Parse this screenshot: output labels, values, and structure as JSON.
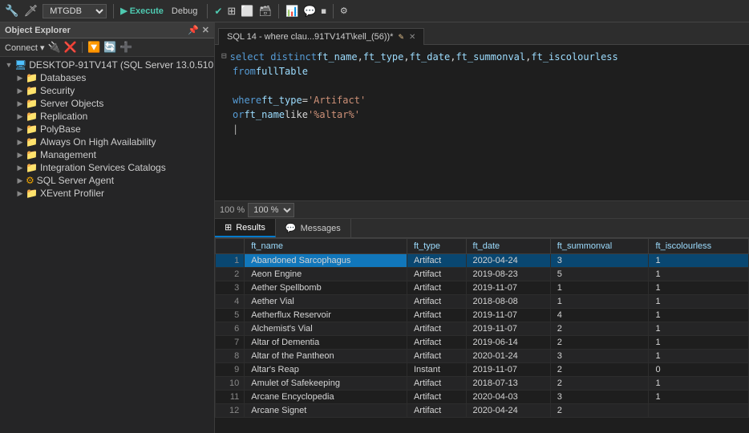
{
  "toolbar": {
    "db_name": "MTGDB",
    "execute_label": "Execute",
    "debug_label": "Debug"
  },
  "object_explorer": {
    "title": "Object Explorer",
    "connect_label": "Connect ▾",
    "server": "DESKTOP-91TV14T (SQL Server 13.0.510",
    "nodes": [
      {
        "id": "databases",
        "label": "Databases",
        "level": 1,
        "expanded": false,
        "icon": "folder"
      },
      {
        "id": "security",
        "label": "Security",
        "level": 1,
        "expanded": false,
        "icon": "folder"
      },
      {
        "id": "server-objects",
        "label": "Server Objects",
        "level": 1,
        "expanded": false,
        "icon": "folder"
      },
      {
        "id": "replication",
        "label": "Replication",
        "level": 1,
        "expanded": false,
        "icon": "folder"
      },
      {
        "id": "polybase",
        "label": "PolyBase",
        "level": 1,
        "expanded": false,
        "icon": "folder"
      },
      {
        "id": "always-on",
        "label": "Always On High Availability",
        "level": 1,
        "expanded": false,
        "icon": "folder"
      },
      {
        "id": "management",
        "label": "Management",
        "level": 1,
        "expanded": false,
        "icon": "folder"
      },
      {
        "id": "integration-services",
        "label": "Integration Services Catalogs",
        "level": 1,
        "expanded": false,
        "icon": "folder"
      },
      {
        "id": "sql-agent",
        "label": "SQL Server Agent",
        "level": 1,
        "expanded": false,
        "icon": "agent"
      },
      {
        "id": "xevent",
        "label": "XEvent Profiler",
        "level": 1,
        "expanded": false,
        "icon": "folder"
      }
    ]
  },
  "tab": {
    "title": "SQL 14 - where clau...91TV14T\\kell_(56))*",
    "modified": true
  },
  "sql_editor": {
    "lines": [
      {
        "type": "block_start",
        "content": "select distinct ft_name, ft_type, ft_date, ft_summonval, ft_iscolourless"
      },
      {
        "type": "indent",
        "content": "from fullTable"
      },
      {
        "type": "indent",
        "content": ""
      },
      {
        "type": "indent",
        "content": "where ft_type = 'Artifact'"
      },
      {
        "type": "indent",
        "content": "or ft_name like '%altar%'"
      },
      {
        "type": "cursor",
        "content": ""
      }
    ]
  },
  "zoom": "100 %",
  "results_tabs": [
    {
      "id": "results",
      "label": "Results",
      "icon": "grid",
      "active": true
    },
    {
      "id": "messages",
      "label": "Messages",
      "icon": "msg",
      "active": false
    }
  ],
  "results_table": {
    "columns": [
      "",
      "ft_name",
      "ft_type",
      "ft_date",
      "ft_summonval",
      "ft_iscolourless"
    ],
    "rows": [
      [
        "1",
        "Abandoned Sarcophagus",
        "Artifact",
        "2020-04-24",
        "3",
        "1"
      ],
      [
        "2",
        "Aeon Engine",
        "Artifact",
        "2019-08-23",
        "5",
        "1"
      ],
      [
        "3",
        "Aether Spellbomb",
        "Artifact",
        "2019-11-07",
        "1",
        "1"
      ],
      [
        "4",
        "Aether Vial",
        "Artifact",
        "2018-08-08",
        "1",
        "1"
      ],
      [
        "5",
        "Aetherflux Reservoir",
        "Artifact",
        "2019-11-07",
        "4",
        "1"
      ],
      [
        "6",
        "Alchemist's Vial",
        "Artifact",
        "2019-11-07",
        "2",
        "1"
      ],
      [
        "7",
        "Altar of Dementia",
        "Artifact",
        "2019-06-14",
        "2",
        "1"
      ],
      [
        "8",
        "Altar of the Pantheon",
        "Artifact",
        "2020-01-24",
        "3",
        "1"
      ],
      [
        "9",
        "Altar's Reap",
        "Instant",
        "2019-11-07",
        "2",
        "0"
      ],
      [
        "10",
        "Amulet of Safekeeping",
        "Artifact",
        "2018-07-13",
        "2",
        "1"
      ],
      [
        "11",
        "Arcane Encyclopedia",
        "Artifact",
        "2020-04-03",
        "3",
        "1"
      ],
      [
        "12",
        "Arcane Signet",
        "Artifact",
        "2020-04-24",
        "2",
        ""
      ]
    ]
  }
}
